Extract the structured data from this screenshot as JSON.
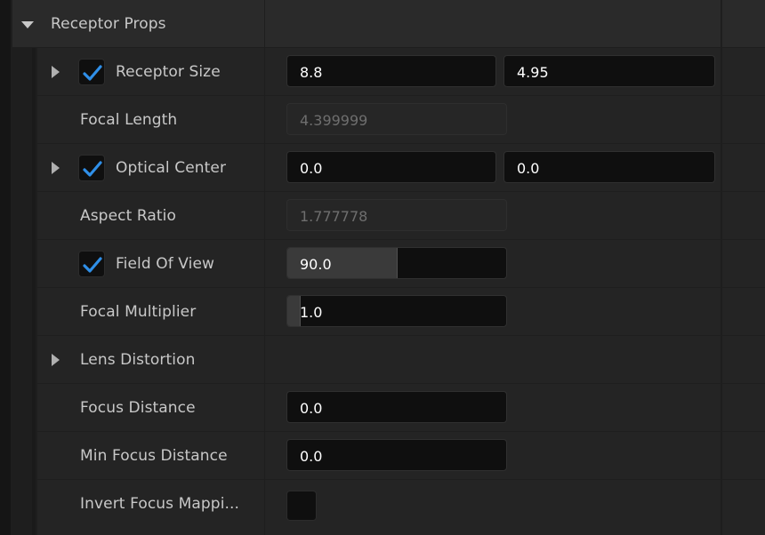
{
  "section": {
    "title": "Receptor Props"
  },
  "rows": {
    "receptor_size": {
      "label": "Receptor Size",
      "value_x": "8.8",
      "value_y": "4.95"
    },
    "focal_length": {
      "label": "Focal Length",
      "value": "4.399999"
    },
    "optical_center": {
      "label": "Optical Center",
      "value_x": "0.0",
      "value_y": "0.0"
    },
    "aspect_ratio": {
      "label": "Aspect Ratio",
      "value": "1.777778"
    },
    "field_of_view": {
      "label": "Field Of View",
      "value": "90.0",
      "slider_fraction": 0.5
    },
    "focal_multiplier": {
      "label": "Focal Multiplier",
      "value": "1.0",
      "slider_fraction": 0.0
    },
    "lens_distortion": {
      "label": "Lens Distortion"
    },
    "focus_distance": {
      "label": "Focus Distance",
      "value": "0.0"
    },
    "min_focus_distance": {
      "label": "Min Focus Distance",
      "value": "0.0"
    },
    "invert_focus_mapping": {
      "label": "Invert Focus Mappi...",
      "checked": false
    }
  },
  "colors": {
    "check": "#2f8fe8",
    "panel": "#242424",
    "field": "#0f0f0f"
  },
  "icons": [
    "collapse-arrow-icon",
    "expand-arrow-icon",
    "checkmark-icon"
  ]
}
